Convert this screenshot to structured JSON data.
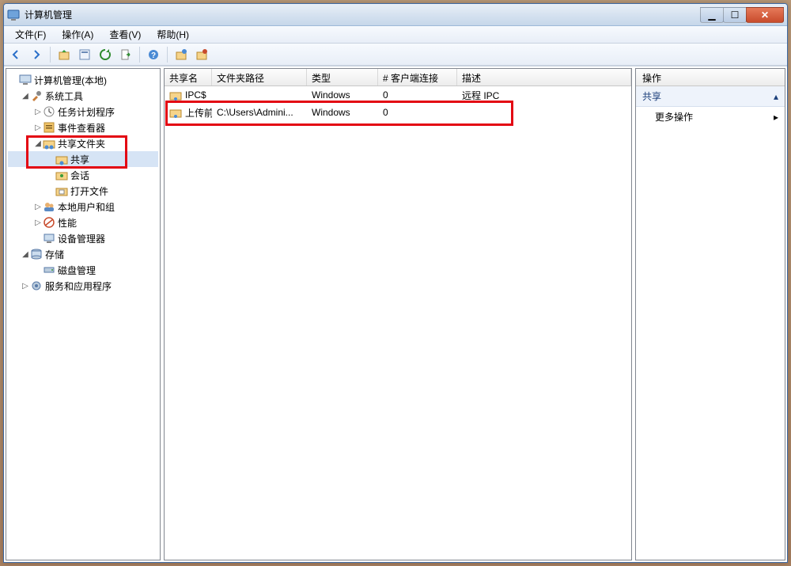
{
  "title": "计算机管理",
  "menu": {
    "file": "文件(F)",
    "action": "操作(A)",
    "view": "查看(V)",
    "help": "帮助(H)"
  },
  "tree": {
    "root": "计算机管理(本地)",
    "sys_tools": "系统工具",
    "task_sched": "任务计划程序",
    "event_viewer": "事件查看器",
    "shared_folders": "共享文件夹",
    "share": "共享",
    "sessions": "会话",
    "open_files": "打开文件",
    "local_users": "本地用户和组",
    "perf": "性能",
    "device_mgr": "设备管理器",
    "storage": "存储",
    "disk_mgmt": "磁盘管理",
    "services_apps": "服务和应用程序"
  },
  "columns": {
    "share_name": "共享名",
    "folder_path": "文件夹路径",
    "type": "类型",
    "clients": "# 客户端连接",
    "desc": "描述"
  },
  "col_widths": {
    "share_name": 60,
    "folder_path": 120,
    "type": 90,
    "clients": 100,
    "desc": 120
  },
  "rows": [
    {
      "name": "IPC$",
      "path": "",
      "type": "Windows",
      "clients": "0",
      "desc": "远程 IPC"
    },
    {
      "name": "上传前",
      "path": "C:\\Users\\Admini...",
      "type": "Windows",
      "clients": "0",
      "desc": ""
    }
  ],
  "actions": {
    "header": "操作",
    "group": "共享",
    "more": "更多操作"
  }
}
